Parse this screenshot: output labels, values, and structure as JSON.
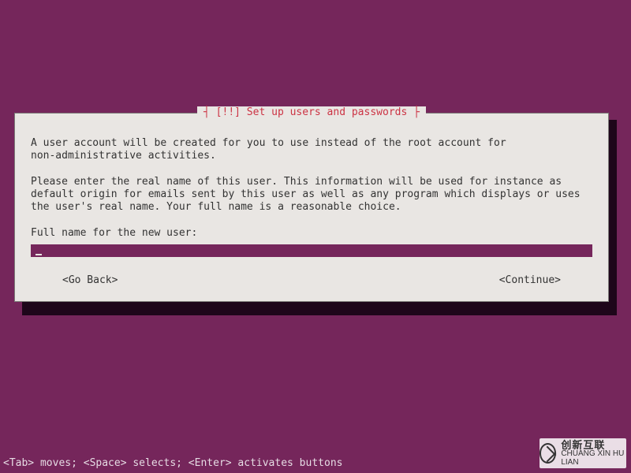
{
  "dialog": {
    "title_prefix": "┤ ",
    "title": "[!!] Set up users and passwords",
    "title_suffix": " ├",
    "description": "A user account will be created for you to use instead of the root account for\nnon-administrative activities.\n\nPlease enter the real name of this user. This information will be used for instance as\ndefault origin for emails sent by this user as well as any program which displays or uses\nthe user's real name. Your full name is a reasonable choice.\n\nFull name for the new user:",
    "input_value": "",
    "go_back": "<Go Back>",
    "continue": "<Continue>"
  },
  "footer": "<Tab> moves; <Space> selects; <Enter> activates buttons",
  "watermark": {
    "cn": "创新互联",
    "en": "CHUANG XIN HU LIAN"
  }
}
